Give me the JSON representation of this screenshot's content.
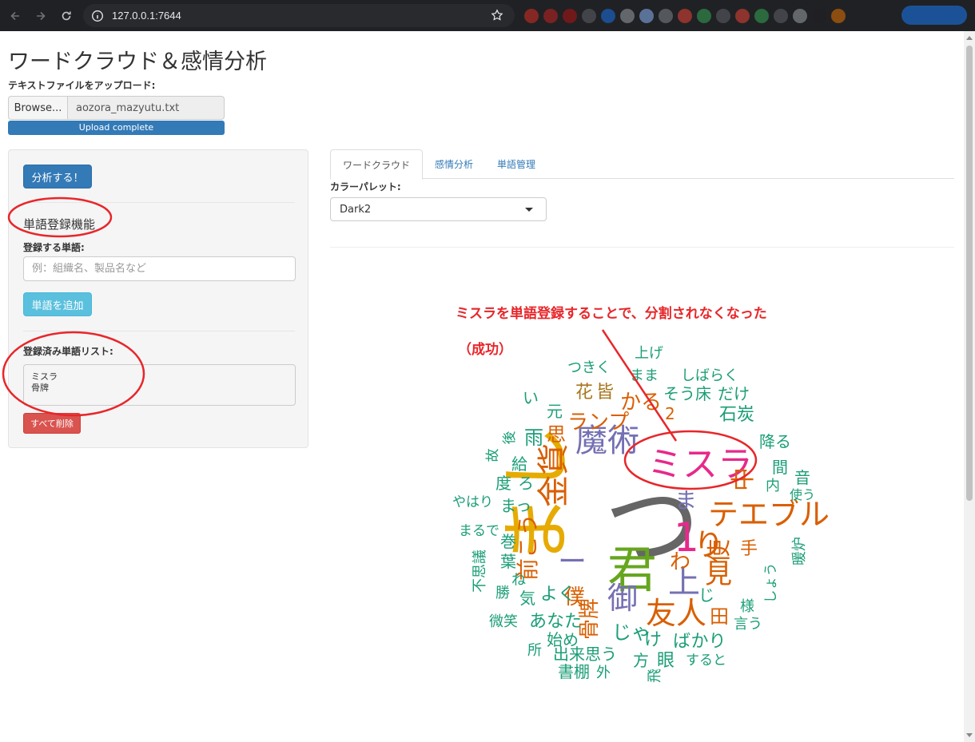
{
  "browser": {
    "url": "127.0.0.1:7644"
  },
  "page": {
    "title": "ワードクラウド＆感情分析",
    "upload_label": "テキストファイルをアップロード:",
    "browse_label": "Browse...",
    "file_name": "aozora_mazyutu.txt",
    "progress_text": "Upload complete",
    "progress": 1.0
  },
  "sidebar": {
    "analyze_button": "分析する！",
    "section_title": "単語登録機能",
    "word_label": "登録する単語:",
    "word_placeholder": "例：組織名、製品名など",
    "add_button": "単語を追加",
    "list_label": "登録済み単語リスト:",
    "registered_words": [
      "ミスラ",
      "骨牌"
    ],
    "delete_all_button": "すべて削除"
  },
  "main": {
    "tabs": [
      {
        "label": "ワードクラウド",
        "active": true
      },
      {
        "label": "感情分析",
        "active": false
      },
      {
        "label": "単語管理",
        "active": false
      }
    ],
    "palette_label": "カラーパレット:",
    "palette_value": "Dark2"
  },
  "annotation": {
    "line1": "ミスラを単語登録することで、分割されなくなった",
    "line2": "（成功）",
    "color": "#e8262a"
  },
  "wordcloud": {
    "palette": [
      "#1b9e77",
      "#d95f02",
      "#7570b3",
      "#e7298a",
      "#66a61e",
      "#e6ab02",
      "#a6761d",
      "#666666"
    ],
    "words": [
      {
        "text": "つ",
        "color": "#666666"
      },
      {
        "text": "まし",
        "color": "#e6ab02"
      },
      {
        "text": "君",
        "color": "#66a61e"
      },
      {
        "text": "ミスラ",
        "color": "#e7298a"
      },
      {
        "text": "魔術",
        "color": "#7570b3"
      },
      {
        "text": "金貨",
        "color": "#d95f02"
      },
      {
        "text": "テエブル",
        "color": "#d95f02"
      },
      {
        "text": "1",
        "color": "#e7298a"
      },
      {
        "text": "り",
        "color": "#d95f02"
      },
      {
        "text": "友人",
        "color": "#d95f02"
      },
      {
        "text": "上",
        "color": "#7570b3"
      },
      {
        "text": "御",
        "color": "#7570b3"
      },
      {
        "text": "見",
        "color": "#d95f02"
      },
      {
        "text": "ー",
        "color": "#7570b3"
      },
      {
        "text": "わ",
        "color": "#d95f02"
      },
      {
        "text": "前こう",
        "color": "#d95f02"
      },
      {
        "text": "使",
        "color": "#d95f02"
      },
      {
        "text": "ランプ",
        "color": "#d95f02"
      },
      {
        "text": "かる",
        "color": "#d95f02"
      },
      {
        "text": "花",
        "color": "#a6761d"
      },
      {
        "text": "皆",
        "color": "#a6761d"
      },
      {
        "text": "2",
        "color": "#d95f02"
      },
      {
        "text": "中",
        "color": "#d95f02"
      },
      {
        "text": "雨",
        "color": "#1b9e77"
      },
      {
        "text": "思",
        "color": "#d95f02"
      },
      {
        "text": "そう",
        "color": "#1b9e77"
      },
      {
        "text": "床",
        "color": "#1b9e77"
      },
      {
        "text": "だけ",
        "color": "#1b9e77"
      },
      {
        "text": "石炭",
        "color": "#1b9e77"
      },
      {
        "text": "降る",
        "color": "#1b9e77"
      },
      {
        "text": "間",
        "color": "#1b9e77"
      },
      {
        "text": "音",
        "color": "#1b9e77"
      },
      {
        "text": "内",
        "color": "#1b9e77"
      },
      {
        "text": "使う",
        "color": "#1b9e77"
      },
      {
        "text": "暖炉",
        "color": "#1b9e77"
      },
      {
        "text": "骨牌",
        "color": "#d95f02"
      },
      {
        "text": "僕",
        "color": "#d95f02"
      },
      {
        "text": "じゃ",
        "color": "#1b9e77"
      },
      {
        "text": "よく",
        "color": "#1b9e77"
      },
      {
        "text": "あなた",
        "color": "#1b9e77"
      },
      {
        "text": "始め",
        "color": "#1b9e77"
      },
      {
        "text": "出来",
        "color": "#1b9e77"
      },
      {
        "text": "思う",
        "color": "#1b9e77"
      },
      {
        "text": "け",
        "color": "#1b9e77"
      },
      {
        "text": "ばかり",
        "color": "#1b9e77"
      },
      {
        "text": "眼",
        "color": "#1b9e77"
      },
      {
        "text": "方",
        "color": "#1b9e77"
      },
      {
        "text": "すると",
        "color": "#1b9e77"
      },
      {
        "text": "書棚",
        "color": "#1b9e77"
      },
      {
        "text": "外",
        "color": "#1b9e77"
      },
      {
        "text": "飛",
        "color": "#1b9e77"
      },
      {
        "text": "所",
        "color": "#1b9e77"
      },
      {
        "text": "微笑",
        "color": "#1b9e77"
      },
      {
        "text": "勝",
        "color": "#1b9e77"
      },
      {
        "text": "気",
        "color": "#1b9e77"
      },
      {
        "text": "不思議",
        "color": "#1b9e77"
      },
      {
        "text": "葉",
        "color": "#1b9e77"
      },
      {
        "text": "巻",
        "color": "#1b9e77"
      },
      {
        "text": "まるで",
        "color": "#1b9e77"
      },
      {
        "text": "やはり",
        "color": "#1b9e77"
      },
      {
        "text": "まっ",
        "color": "#1b9e77"
      },
      {
        "text": "度",
        "color": "#1b9e77"
      },
      {
        "text": "ろ",
        "color": "#1b9e77"
      },
      {
        "text": "給",
        "color": "#1b9e77"
      },
      {
        "text": "故",
        "color": "#1b9e77"
      },
      {
        "text": "後",
        "color": "#1b9e77"
      },
      {
        "text": "元",
        "color": "#1b9e77"
      },
      {
        "text": "つきく",
        "color": "#1b9e77"
      },
      {
        "text": "上げ",
        "color": "#1b9e77"
      },
      {
        "text": "まま",
        "color": "#1b9e77"
      },
      {
        "text": "しばらく",
        "color": "#1b9e77"
      },
      {
        "text": "言う",
        "color": "#1b9e77"
      },
      {
        "text": "様",
        "color": "#1b9e77"
      },
      {
        "text": "しょう",
        "color": "#1b9e77"
      },
      {
        "text": "田",
        "color": "#d95f02"
      },
      {
        "text": "じ",
        "color": "#1b9e77"
      },
      {
        "text": "手",
        "color": "#d95f02"
      },
      {
        "text": "ね",
        "color": "#1b9e77"
      },
      {
        "text": "ま",
        "color": "#7570b3"
      },
      {
        "text": "い",
        "color": "#1b9e77"
      }
    ]
  }
}
